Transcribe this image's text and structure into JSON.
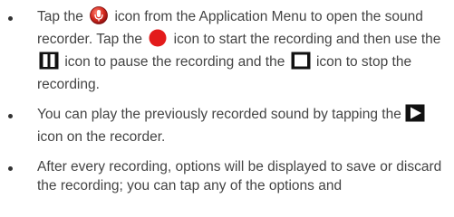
{
  "icons": {
    "recorder": "recorder-app-icon",
    "record": "record-red-circle-icon",
    "pause": "pause-icon",
    "stop": "stop-icon",
    "play": "play-icon"
  },
  "colors": {
    "text": "#444444",
    "record_red": "#e31b1b",
    "recorder_red": "#cc1f1f"
  },
  "bullets": [
    {
      "parts": [
        "Tap the",
        "icon from the Application Menu to open the sound recorder. Tap the",
        "icon to start the recording and then use the",
        "icon to pause the recording and the",
        "icon to stop the recording."
      ]
    },
    {
      "parts": [
        "You can play the previously recorded sound by tapping the",
        "icon on the recorder."
      ]
    },
    {
      "parts": [
        "After every recording, options will be displayed to save or discard the recording; you can tap any of the options and"
      ]
    }
  ]
}
